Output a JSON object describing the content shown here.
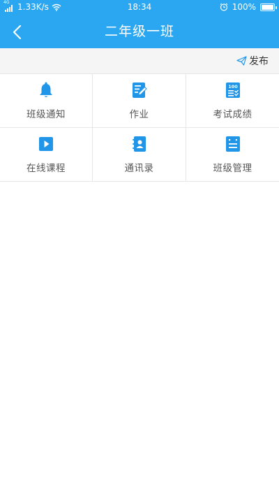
{
  "status_bar": {
    "network_type": "4G",
    "speed": "1.33K/s",
    "time": "18:34",
    "battery": "100%"
  },
  "nav": {
    "title": "二年级一班"
  },
  "actions": {
    "publish_label": "发布"
  },
  "grid": [
    {
      "label": "班级通知",
      "icon": "bell-icon"
    },
    {
      "label": "作业",
      "icon": "homework-edit-icon"
    },
    {
      "label": "考试成绩",
      "icon": "exam-score-icon"
    },
    {
      "label": "在线课程",
      "icon": "video-play-icon"
    },
    {
      "label": "通讯录",
      "icon": "contacts-book-icon"
    },
    {
      "label": "班级管理",
      "icon": "class-manage-icon"
    }
  ],
  "colors": {
    "primary": "#2aa7f0",
    "icon": "#2196e8",
    "divider": "#e6e6e6",
    "toolbar_bg": "#f5f5f5",
    "label": "#555555"
  }
}
